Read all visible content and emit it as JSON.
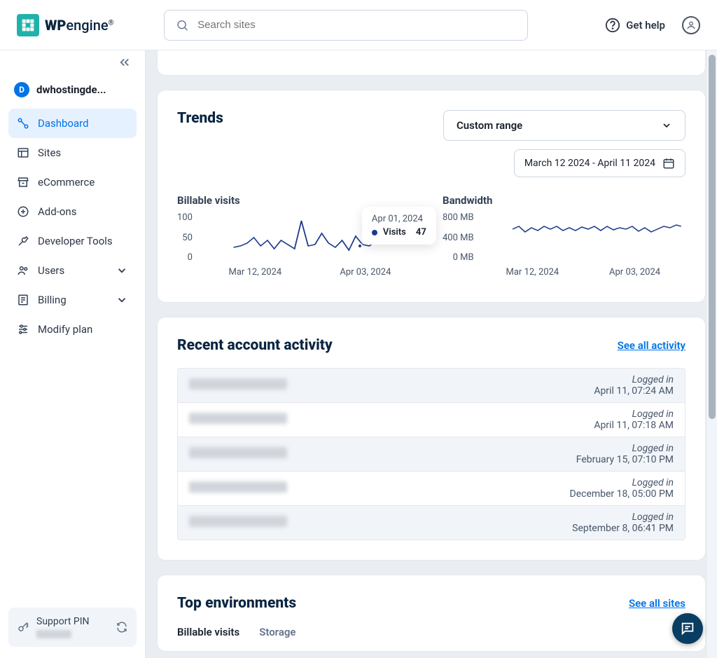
{
  "brand": {
    "wp": "WP",
    "engine": "engine",
    "r": "®"
  },
  "search": {
    "placeholder": "Search sites"
  },
  "header": {
    "get_help": "Get help"
  },
  "account": {
    "initial": "D",
    "name": "dwhostingde..."
  },
  "nav": {
    "dashboard": "Dashboard",
    "sites": "Sites",
    "ecommerce": "eCommerce",
    "addons": "Add-ons",
    "devtools": "Developer Tools",
    "users": "Users",
    "billing": "Billing",
    "modify": "Modify plan"
  },
  "support_pin": {
    "label": "Support PIN"
  },
  "trends": {
    "title": "Trends",
    "range_label": "Custom range",
    "date_range": "March 12 2024 - April 11 2024",
    "billable": {
      "title": "Billable visits",
      "y": [
        "100",
        "50",
        "0"
      ],
      "x": [
        "Mar 12, 2024",
        "Apr 03, 2024"
      ],
      "tooltip_date": "Apr 01, 2024",
      "tooltip_label": "Visits",
      "tooltip_value": "47"
    },
    "bandwidth": {
      "title": "Bandwidth",
      "y": [
        "800 MB",
        "400 MB",
        "0 MB"
      ],
      "x": [
        "Mar 12, 2024",
        "Apr 03, 2024"
      ]
    }
  },
  "activity": {
    "title": "Recent account activity",
    "see_all": "See all activity",
    "rows": [
      {
        "action": "Logged in",
        "time": "April 11, 07:24 AM"
      },
      {
        "action": "Logged in",
        "time": "April 11, 07:18 AM"
      },
      {
        "action": "Logged in",
        "time": "February 15, 07:10 PM"
      },
      {
        "action": "Logged in",
        "time": "December 18, 05:00 PM"
      },
      {
        "action": "Logged in",
        "time": "September 8, 06:41 PM"
      }
    ]
  },
  "environments": {
    "title": "Top environments",
    "see_all": "See all sites",
    "tabs": [
      "Billable visits",
      "Storage"
    ]
  },
  "chart_data": [
    {
      "type": "line",
      "title": "Billable visits",
      "xlabel": "",
      "ylabel": "",
      "ylim": [
        0,
        100
      ],
      "x_range": [
        "Mar 12, 2024",
        "Apr 11, 2024"
      ],
      "series": [
        {
          "name": "Visits",
          "values": [
            30,
            30,
            40,
            55,
            35,
            50,
            32,
            50,
            40,
            30,
            85,
            38,
            40,
            60,
            42,
            35,
            48,
            30,
            55,
            40,
            38,
            48,
            45,
            47,
            48,
            45,
            42,
            44,
            45,
            43,
            44
          ],
          "annotation": {
            "date": "Apr 01, 2024",
            "value": 47
          }
        }
      ]
    },
    {
      "type": "line",
      "title": "Bandwidth",
      "xlabel": "",
      "ylabel": "",
      "ylim": [
        0,
        800
      ],
      "y_unit": "MB",
      "x_range": [
        "Mar 12, 2024",
        "Apr 11, 2024"
      ],
      "series": [
        {
          "name": "Bandwidth",
          "values": [
            520,
            560,
            480,
            540,
            500,
            560,
            520,
            560,
            510,
            540,
            500,
            550,
            520,
            560,
            500,
            560,
            510,
            540,
            520,
            560,
            490,
            540,
            480,
            520,
            560,
            540,
            580,
            510,
            540,
            500,
            560
          ]
        }
      ]
    }
  ]
}
